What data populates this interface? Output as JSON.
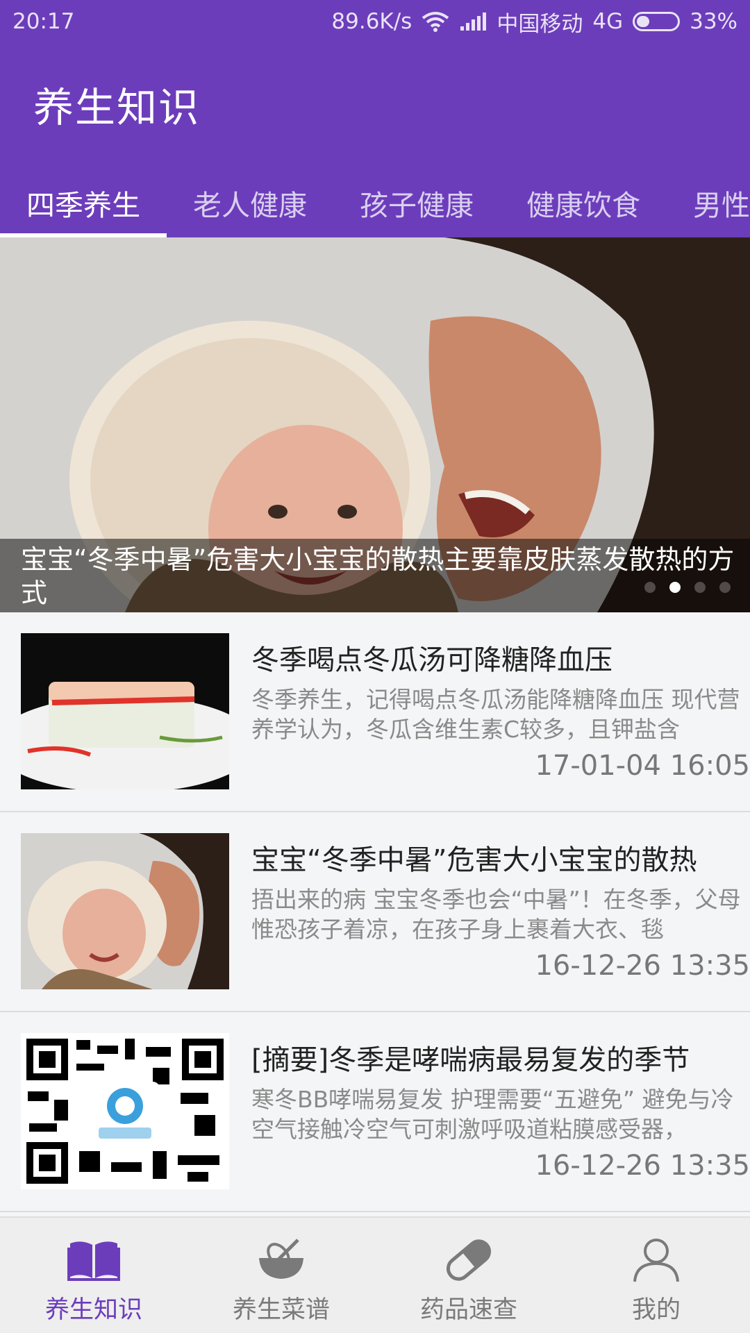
{
  "status_bar": {
    "time": "20:17",
    "network_speed": "89.6K/s",
    "carrier": "中国移动",
    "network_type": "4G",
    "battery": "33%"
  },
  "app": {
    "title": "养生知识"
  },
  "tabs": [
    {
      "label": "四季养生",
      "active": true
    },
    {
      "label": "老人健康",
      "active": false
    },
    {
      "label": "孩子健康",
      "active": false
    },
    {
      "label": "健康饮食",
      "active": false
    },
    {
      "label": "男性",
      "active": false
    }
  ],
  "banner": {
    "caption": "宝宝“冬季中暑”危害大小宝宝的散热主要靠皮肤蒸发散热的方式",
    "dots_count": 4,
    "active_dot": 1
  },
  "articles": [
    {
      "title": "冬季喝点冬瓜汤可降糖降血压",
      "summary": "冬季养生，记得喝点冬瓜汤能降糖降血压 现代营养学认为，冬瓜含维生素C较多，且钾盐含",
      "date": "17-01-04 16:05",
      "thumb": "winter-melon-dish"
    },
    {
      "title": "宝宝“冬季中暑”危害大小宝宝的散热",
      "summary": "捂出来的病 宝宝冬季也会“中暑”！在冬季，父母惟恐孩子着凉，在孩子身上裹着大衣、毯",
      "date": "16-12-26 13:35",
      "thumb": "mother-and-baby"
    },
    {
      "title": "[摘要]冬季是哮喘病最易复发的季节",
      "summary": "寒冬BB哮喘易复发 护理需要“五避免” 避免与冷空气接触冷空气可刺激呼吸道粘膜感受器，",
      "date": "16-12-26 13:35",
      "thumb": "qr-code"
    }
  ],
  "bottom_nav": [
    {
      "label": "养生知识",
      "icon": "book-icon",
      "active": true
    },
    {
      "label": "养生菜谱",
      "icon": "mixing-bowl-icon",
      "active": false
    },
    {
      "label": "药品速查",
      "icon": "pill-icon",
      "active": false
    },
    {
      "label": "我的",
      "icon": "user-icon",
      "active": false
    }
  ],
  "colors": {
    "primary": "#6c3dbb",
    "background": "#f4f5f6",
    "nav_background": "#eeeeee"
  }
}
